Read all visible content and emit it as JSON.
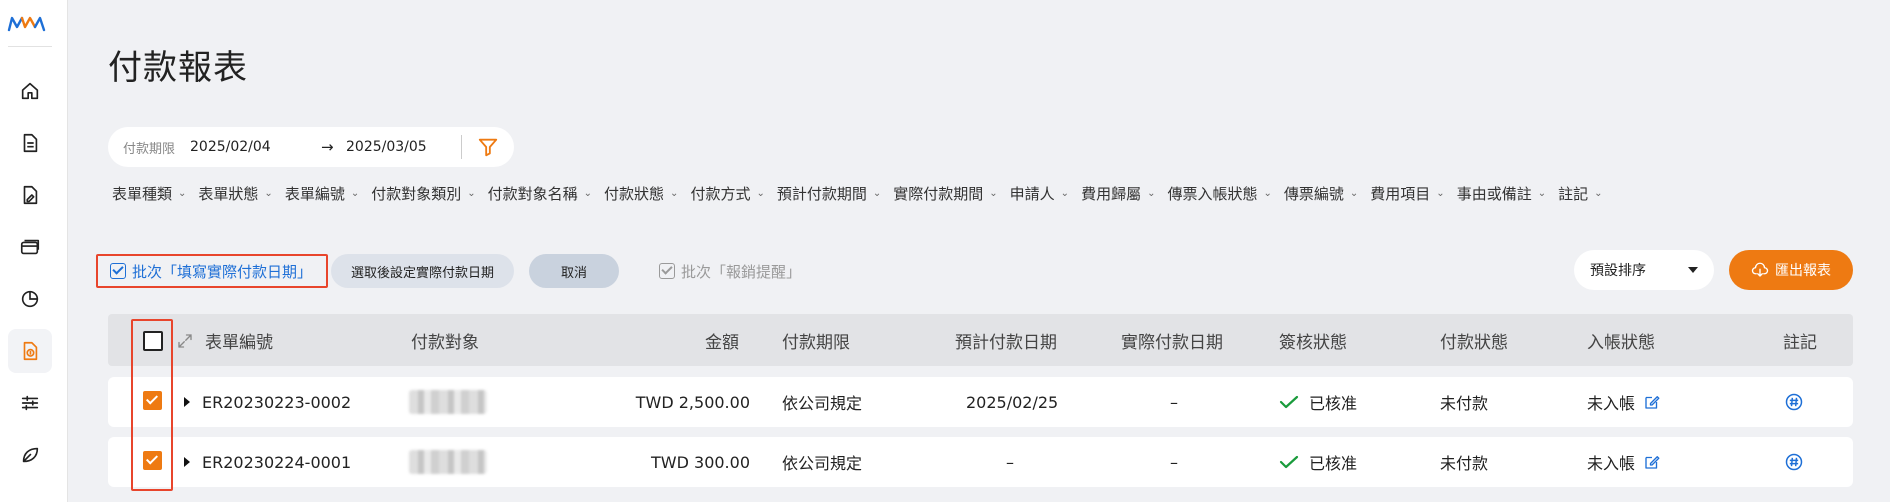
{
  "colors": {
    "accent_orange": "#ee7a12",
    "highlight_red": "#e8452c",
    "link_blue": "#1e6fd6",
    "approved_green": "#1a9b3c"
  },
  "sidebar": {
    "logo": "mm-logo",
    "items": [
      {
        "icon": "home-icon"
      },
      {
        "icon": "document-icon"
      },
      {
        "icon": "file-edit-icon"
      },
      {
        "icon": "card-icon"
      },
      {
        "icon": "pie-chart-icon"
      },
      {
        "icon": "payment-report-icon",
        "active": true
      },
      {
        "icon": "sliders-icon"
      },
      {
        "icon": "leaf-icon"
      }
    ]
  },
  "page": {
    "title": "付款報表"
  },
  "date_range": {
    "label": "付款期限",
    "start": "2025/02/04",
    "arrow": "→",
    "end": "2025/03/05",
    "filter_icon": "filter-icon"
  },
  "filters": [
    "表單種類",
    "表單狀態",
    "表單編號",
    "付款對象類別",
    "付款對象名稱",
    "付款狀態",
    "付款方式",
    "預計付款期間",
    "實際付款期間",
    "申請人",
    "費用歸屬",
    "傳票入帳狀態",
    "傳票編號",
    "費用項目",
    "事由或備註",
    "註記"
  ],
  "actions": {
    "batch_fill_date": "批次「填寫實際付款日期」",
    "set_date_after_select": "選取後設定實際付款日期",
    "cancel": "取消",
    "batch_remind": "批次「報銷提醒」",
    "sort": "預設排序",
    "export": "匯出報表"
  },
  "table": {
    "columns": [
      "表單編號",
      "付款對象",
      "金額",
      "付款期限",
      "預計付款日期",
      "實際付款日期",
      "簽核狀態",
      "付款狀態",
      "入帳狀態",
      "註記"
    ],
    "rows": [
      {
        "checked": true,
        "form_no": "ER20230223-0002",
        "amount": "TWD 2,500.00",
        "deadline": "依公司規定",
        "expected_date": "2025/02/25",
        "actual_date": "–",
        "approval": "已核准",
        "pay_status": "未付款",
        "post_status": "未入帳"
      },
      {
        "checked": true,
        "form_no": "ER20230224-0001",
        "amount": "TWD 300.00",
        "deadline": "依公司規定",
        "expected_date": "–",
        "actual_date": "–",
        "approval": "已核准",
        "pay_status": "未付款",
        "post_status": "未入帳"
      }
    ]
  }
}
